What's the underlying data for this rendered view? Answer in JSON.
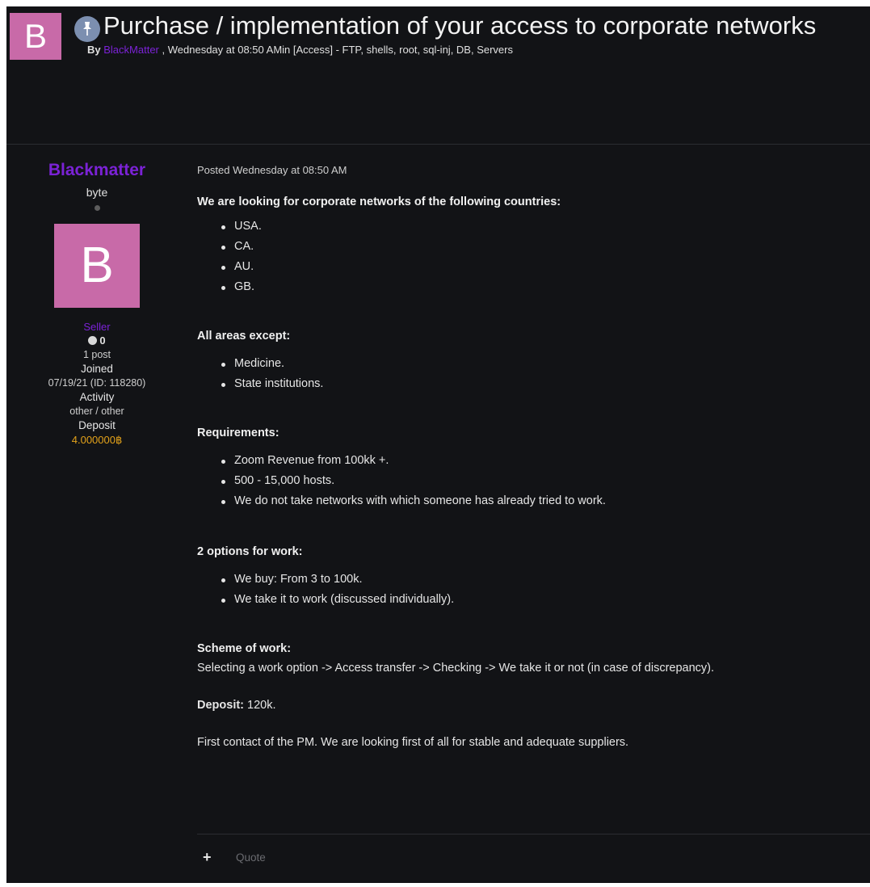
{
  "header": {
    "avatar_letter": "B",
    "title": "Purchase / implementation of your access to corporate networks",
    "by_label": "By",
    "author": "BlackMatter",
    "meta_rest": ", Wednesday at 08:50 AMin [Access] - FTP, shells, root, sql-inj, DB, Servers"
  },
  "sidebar": {
    "username": "Blackmatter",
    "rank": "byte",
    "avatar_letter": "B",
    "group": "Seller",
    "reputation": "0",
    "posts": "1 post",
    "joined_label": "Joined",
    "joined_value": "07/19/21 (ID: 118280)",
    "activity_label": "Activity",
    "activity_value": "other / other",
    "deposit_label": "Deposit",
    "deposit_value": "4.000000฿"
  },
  "post": {
    "posted": "Posted Wednesday at 08:50 AM",
    "countries_heading": "We are looking for corporate networks of the following countries:",
    "countries": [
      "USA.",
      "CA.",
      "AU.",
      "GB."
    ],
    "areas_heading": "All areas except:",
    "areas": [
      "Medicine.",
      "State institutions."
    ],
    "requirements_heading": "Requirements:",
    "requirements": [
      "Zoom Revenue from 100kk +.",
      "500 - 15,000 hosts.",
      "We do not take networks with which someone has already tried to work."
    ],
    "options_heading": "2 options for work:",
    "options": [
      "We buy: From 3 to 100k.",
      "We take it to work (discussed individually)."
    ],
    "scheme_heading": "Scheme of work:",
    "scheme_text": "Selecting a work option -> Access transfer -> Checking -> We take it or not (in case of discrepancy).",
    "deposit_label": "Deposit:",
    "deposit_value": " 120k.",
    "closing": "First contact of the PM. We are looking first of all for stable and adequate suppliers."
  },
  "footer": {
    "plus": "+",
    "quote": "Quote"
  }
}
